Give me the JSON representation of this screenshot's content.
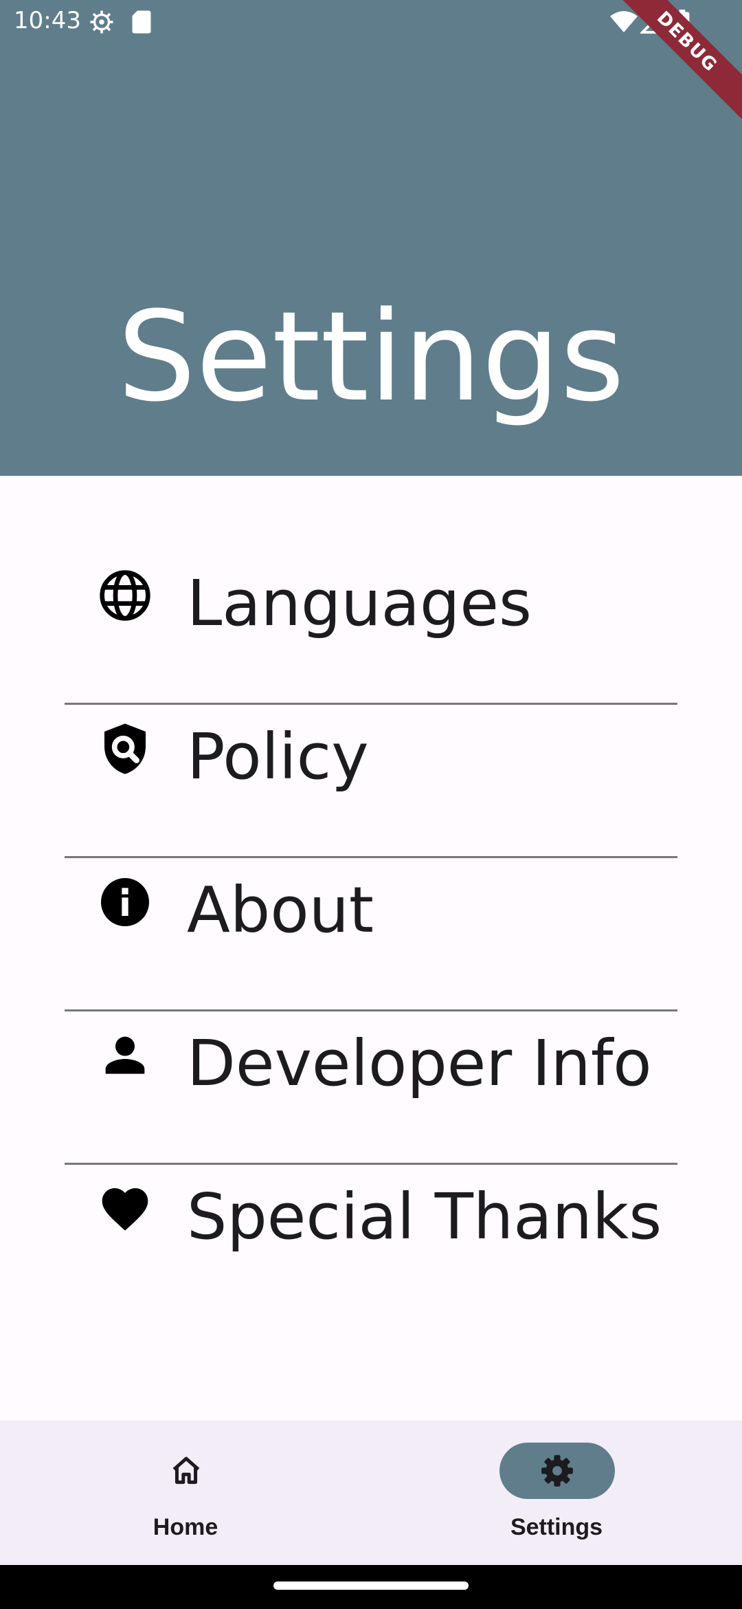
{
  "status_bar": {
    "time": "10:43"
  },
  "debug_banner": "DEBUG",
  "header": {
    "title": "Settings",
    "color": "#607d8b"
  },
  "menu": {
    "items": [
      {
        "label": "Languages",
        "icon": "globe-icon"
      },
      {
        "label": "Policy",
        "icon": "shield-search-icon"
      },
      {
        "label": "About",
        "icon": "info-icon"
      },
      {
        "label": "Developer Info",
        "icon": "person-icon"
      },
      {
        "label": "Special Thanks",
        "icon": "heart-icon"
      }
    ]
  },
  "bottom_nav": {
    "items": [
      {
        "label": "Home",
        "icon": "home-icon",
        "selected": false
      },
      {
        "label": "Settings",
        "icon": "gear-icon",
        "selected": true
      }
    ]
  }
}
